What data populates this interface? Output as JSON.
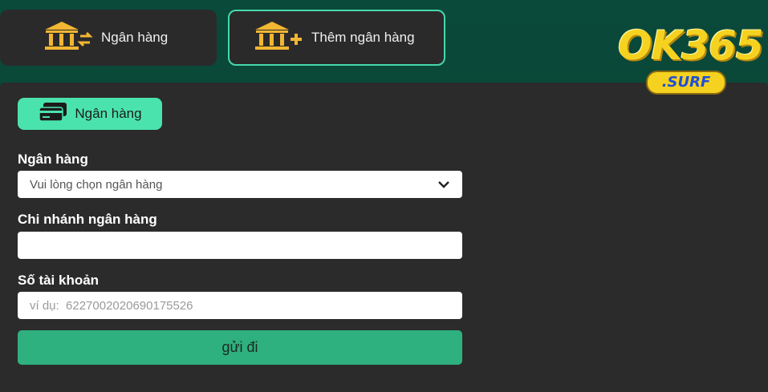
{
  "tabs": {
    "bank_label": "Ngân hàng",
    "add_bank_label": "Thêm ngân hàng"
  },
  "section": {
    "chip_label": "Ngân hàng"
  },
  "form": {
    "bank_label": "Ngân hàng",
    "bank_select_value": "Vui lòng chọn ngân hàng",
    "branch_label": "Chi nhánh ngân hàng",
    "branch_value": "",
    "account_label": "Số tài khoản",
    "account_placeholder": "ví dụ:  6227002020690175526",
    "submit_label": "gửi đi"
  },
  "logo": {
    "main": "OK365",
    "sub": ".SURF"
  },
  "colors": {
    "background": "#0a4a3a",
    "panel": "#2b2b2b",
    "accent": "#4be3ad",
    "button": "#2eb07f",
    "icon_gold": "#f2b632"
  },
  "icons": [
    "bank-transfer-icon",
    "bank-add-icon",
    "cards-icon",
    "chevron-down-icon"
  ]
}
